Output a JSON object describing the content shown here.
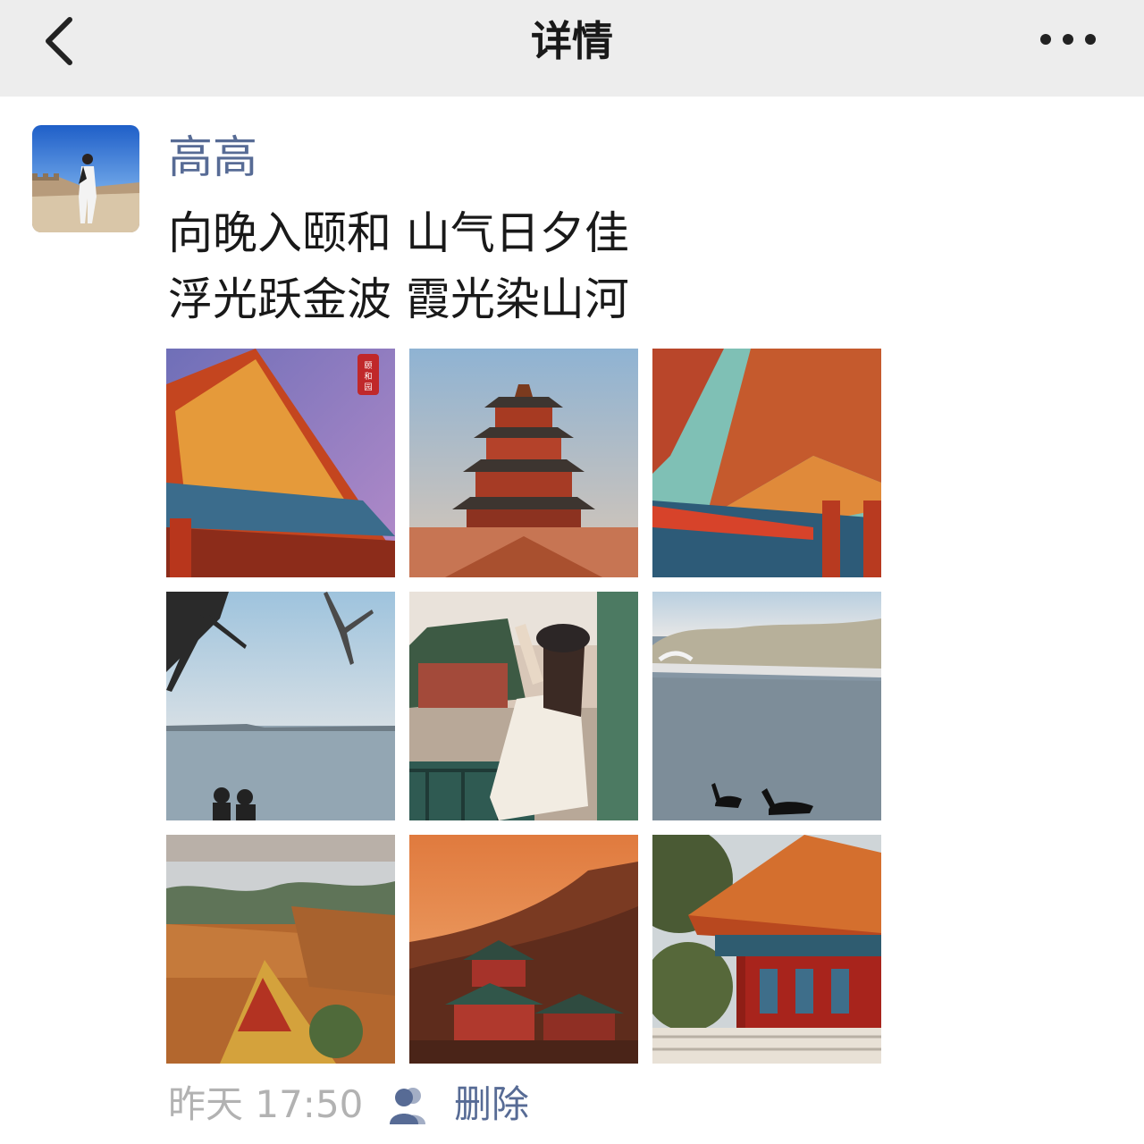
{
  "header": {
    "title": "详情",
    "back_icon": "chevron-left-icon",
    "more_icon": "more-horizontal-icon"
  },
  "post": {
    "author": "高高",
    "text_lines": [
      "向晚入颐和 山气日夕佳",
      "浮光跃金波 霞光染山河"
    ],
    "photos": [
      {
        "name": "photo-palace-eaves-purple-sky",
        "stamp": "颐和园"
      },
      {
        "name": "photo-foxiang-tower"
      },
      {
        "name": "photo-palace-roof-corners"
      },
      {
        "name": "photo-lake-tree-silhouette"
      },
      {
        "name": "photo-woman-in-pavilion"
      },
      {
        "name": "photo-lake-black-swans"
      },
      {
        "name": "photo-rooftops-over-lake"
      },
      {
        "name": "photo-sunset-hillside-temples"
      },
      {
        "name": "photo-red-pavilion-trees"
      }
    ],
    "timestamp": "昨天 17:50",
    "visibility_icon": "friends-icon",
    "delete_label": "删除"
  },
  "colors": {
    "link": "#576b95",
    "navbar_bg": "#ededed",
    "timestamp": "#b2b2b2"
  }
}
